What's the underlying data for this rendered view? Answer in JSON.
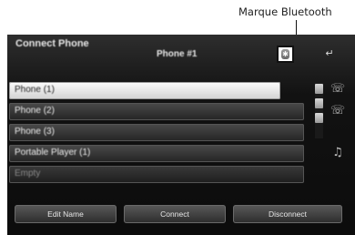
{
  "annotation": {
    "label": "Marque Bluetooth"
  },
  "screen": {
    "title": "Connect Phone",
    "subtitle": "Phone #1",
    "rows": [
      {
        "label": "Phone (1)",
        "selected": true
      },
      {
        "label": "Phone (2)",
        "selected": false
      },
      {
        "label": "Phone (3)",
        "selected": false
      },
      {
        "label": "Portable Player (1)",
        "selected": false
      },
      {
        "label": "Empty",
        "selected": false
      }
    ],
    "icons": {
      "back": "back-arrow-icon",
      "bluetooth_mark": "bluetooth-mark-icon",
      "phone": "phone-icon",
      "audio": "audio-player-icon"
    },
    "buttons": [
      {
        "label": "Edit Name"
      },
      {
        "label": "Connect"
      },
      {
        "label": "Disconnect"
      }
    ]
  }
}
